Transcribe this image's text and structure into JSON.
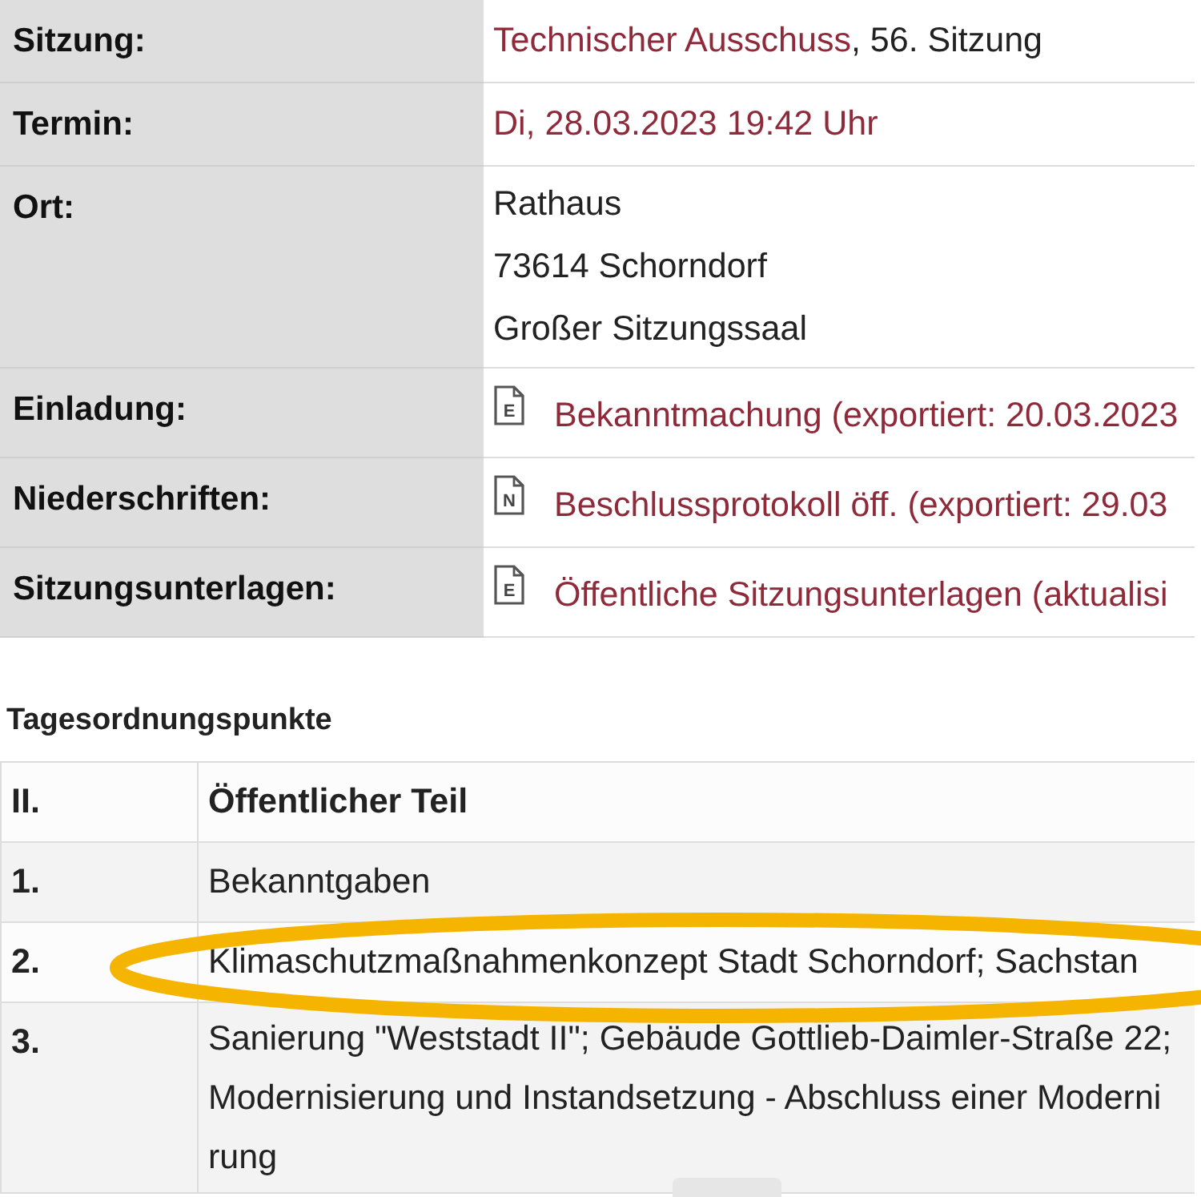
{
  "details": [
    {
      "label": "Sitzung:",
      "kind": "link_text",
      "link": "Technischer Ausschuss",
      "text": ", 56. Sitzung"
    },
    {
      "label": "Termin:",
      "kind": "link",
      "link": "Di, 28.03.2023 19:42 Uhr"
    },
    {
      "label": "Ort:",
      "kind": "lines",
      "lines": [
        "Rathaus",
        "73614 Schorndorf",
        "Großer Sitzungssaal"
      ]
    },
    {
      "label": "Einladung:",
      "kind": "document",
      "icon_letter": "E",
      "link": "Bekanntmachung (exportiert: 20.03.2023"
    },
    {
      "label": "Niederschriften:",
      "kind": "document",
      "icon_letter": "N",
      "link": "Beschlussprotokoll öff. (exportiert: 29.03"
    },
    {
      "label": "Sitzungsunterlagen:",
      "kind": "document",
      "icon_letter": "E",
      "link": "Öffentliche Sitzungsunterlagen (aktualisi"
    }
  ],
  "agenda": {
    "heading": "Tagesordnungspunkte",
    "rows": [
      {
        "number": "II.",
        "kind": "section",
        "lines": [
          "Öffentlicher Teil"
        ],
        "highlighted": false
      },
      {
        "number": "1.",
        "kind": "item",
        "lines": [
          "Bekanntgaben"
        ],
        "highlighted": false
      },
      {
        "number": "2.",
        "kind": "item",
        "lines": [
          "Klimaschutzmaßnahmenkonzept Stadt Schorndorf; Sachstan"
        ],
        "highlighted": true
      },
      {
        "number": "3.",
        "kind": "item",
        "lines": [
          "Sanierung \"Weststadt II\"; Gebäude Gottlieb-Daimler-Straße 22;",
          "Modernisierung und Instandsetzung - Abschluss einer Moderni",
          "rung"
        ],
        "highlighted": false
      }
    ]
  }
}
